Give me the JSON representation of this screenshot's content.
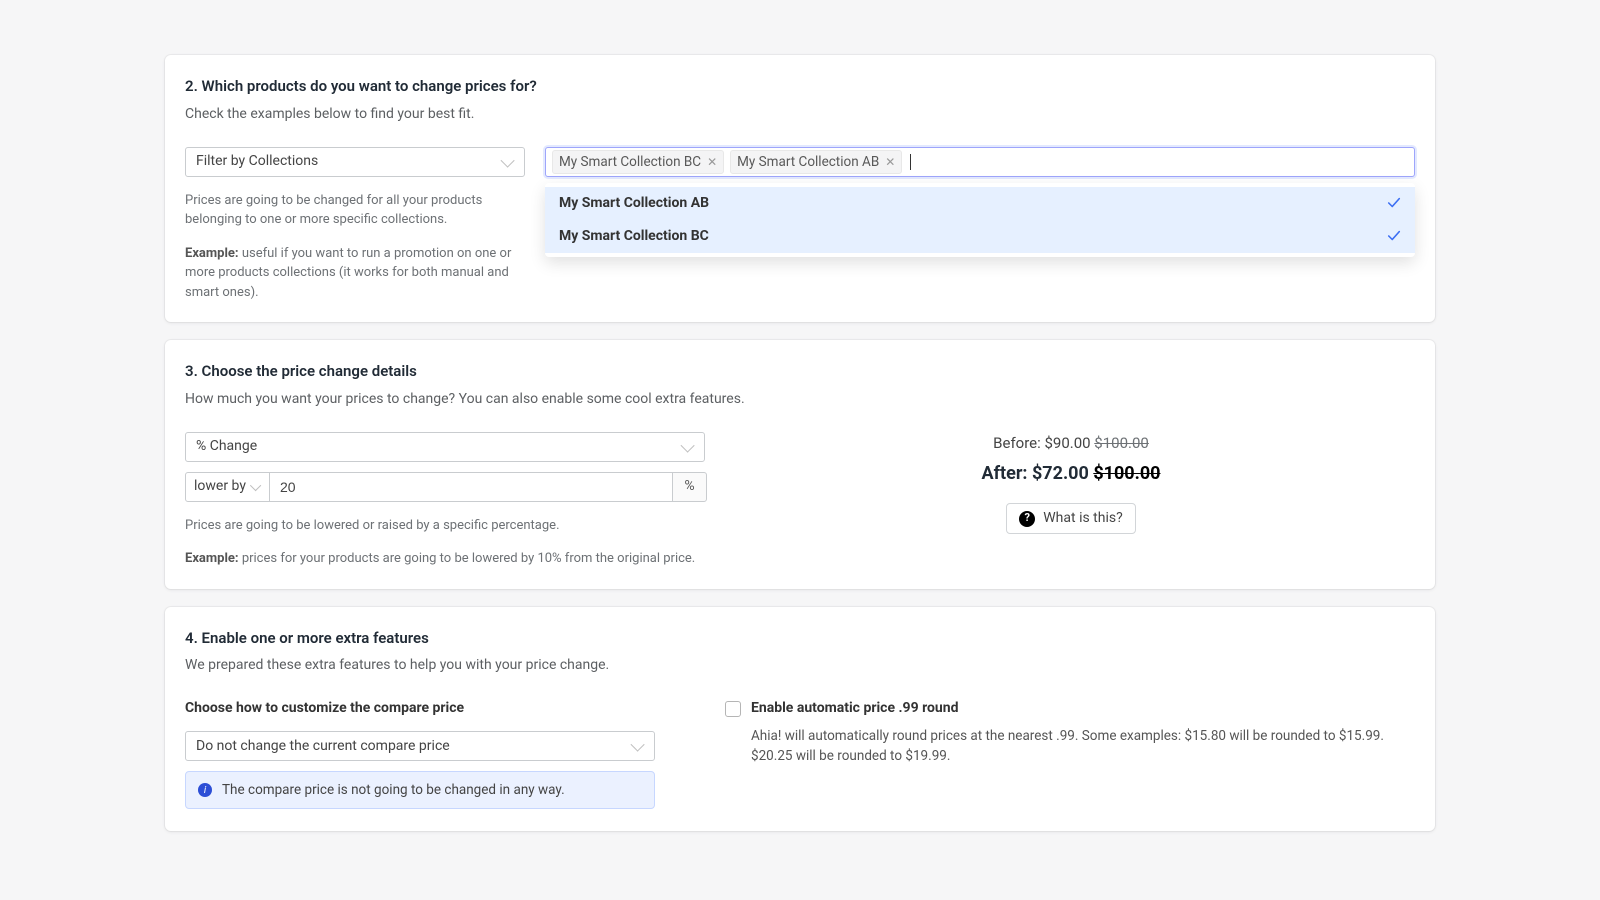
{
  "section2": {
    "title": "2. Which products do you want to change prices for?",
    "sub": "Check the examples below to find your best fit.",
    "filter_select": "Filter by Collections",
    "tags": [
      {
        "label": "My Smart Collection BC"
      },
      {
        "label": "My Smart Collection AB"
      }
    ],
    "dropdown": [
      {
        "label": "My Smart Collection AB"
      },
      {
        "label": "My Smart Collection BC"
      }
    ],
    "hint1": "Prices are going to be changed for all your products belonging to one or more specific collections.",
    "hint2_label": "Example:",
    "hint2_text": " useful if you want to run a promotion on one or more products collections (it works for both manual and smart ones)."
  },
  "section3": {
    "title": "3. Choose the price change details",
    "sub": "How much you want your prices to change? You can also enable some cool extra features.",
    "change_type": "% Change",
    "direction": "lower by",
    "amount": "20",
    "unit": "%",
    "hint1": "Prices are going to be lowered or raised by a specific percentage.",
    "hint2_label": "Example:",
    "hint2_text": " prices for your products are going to be lowered by 10% from the original price.",
    "preview": {
      "before_label": "Before: ",
      "before_price": "$90.00 ",
      "before_compare": "$100.00",
      "after_label": "After: ",
      "after_price": "$72.00 ",
      "after_compare": "$100.00"
    },
    "what_label": "What is this?"
  },
  "section4": {
    "title": "4. Enable one or more extra features",
    "sub": "We prepared these extra features to help you with your price change.",
    "compare_heading": "Choose how to customize the compare price",
    "compare_select": "Do not change the current compare price",
    "compare_info": "The compare price is not going to be changed in any way.",
    "round_heading": "Enable automatic price .99 round",
    "round_desc": "Ahia! will automatically round prices at the nearest .99. Some examples: $15.80 will be rounded to $15.99. $20.25 will be rounded to $19.99."
  }
}
